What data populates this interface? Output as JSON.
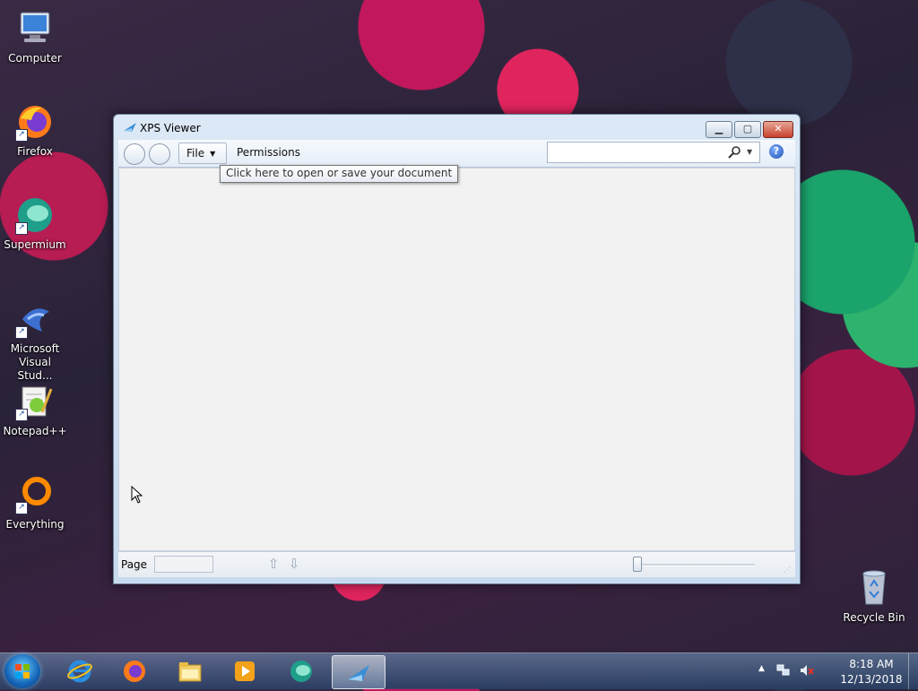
{
  "desktop": {
    "icons": [
      {
        "label": "Computer"
      },
      {
        "label": "Firefox"
      },
      {
        "label": "Supermium"
      },
      {
        "label": "Microsoft Visual Stud..."
      },
      {
        "label": "Notepad++"
      },
      {
        "label": "Everything"
      },
      {
        "label": "Recycle Bin"
      }
    ]
  },
  "window": {
    "title": "XPS Viewer",
    "controls": {
      "minimize": "▁",
      "maximize": "▢",
      "close": "✕"
    },
    "toolbar": {
      "file_label": "File",
      "permissions_label": "Permissions",
      "search_value": "",
      "help_label": "?"
    },
    "tooltip": "Click here to open or save your document",
    "statusbar": {
      "page_label": "Page",
      "page_value": "",
      "up_arrow": "⇧",
      "down_arrow": "⇩"
    }
  },
  "taskbar": {
    "clock_time": "8:18 AM",
    "clock_date": "12/13/2018",
    "tray_arrow": "▲"
  },
  "colors": {
    "accent": "#1f4fb5",
    "close_button": "#c7412d"
  }
}
